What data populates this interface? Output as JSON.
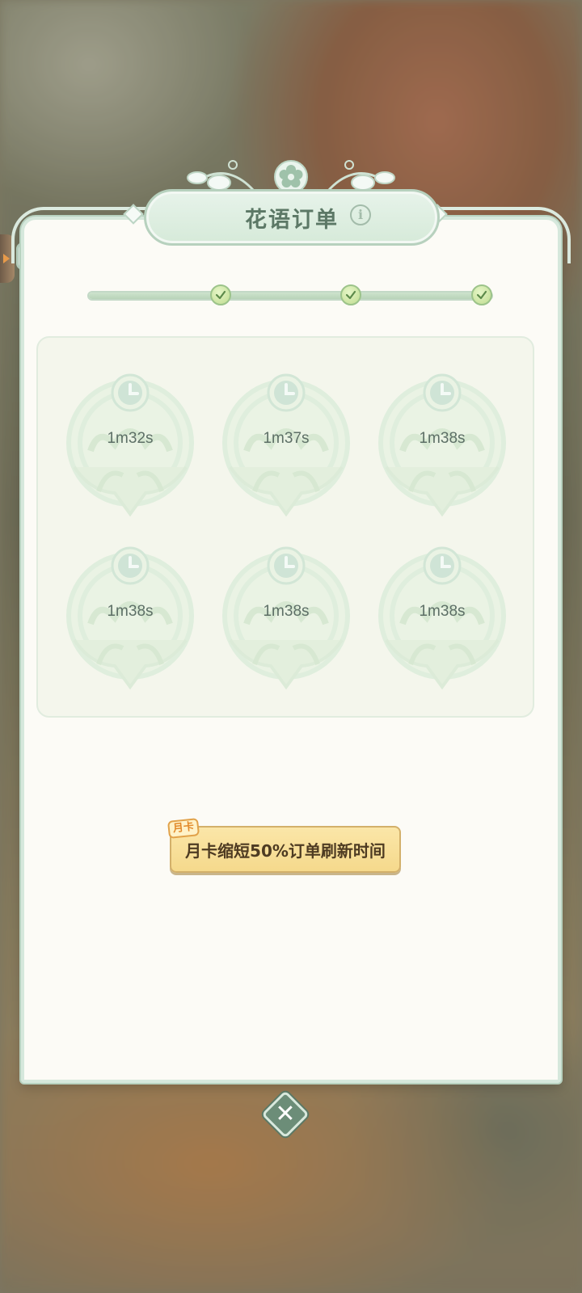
{
  "header": {
    "title": "花语订单",
    "info_icon": "info-icon"
  },
  "progress": {
    "fraction": 1.0,
    "milestones": [
      {
        "icon": "check-icon",
        "completed": true
      },
      {
        "icon": "check-icon",
        "completed": true
      },
      {
        "icon": "check-icon",
        "completed": true
      }
    ]
  },
  "orders": [
    {
      "time": "1m32s",
      "icon": "clock-icon"
    },
    {
      "time": "1m37s",
      "icon": "clock-icon"
    },
    {
      "time": "1m38s",
      "icon": "clock-icon"
    },
    {
      "time": "1m38s",
      "icon": "clock-icon"
    },
    {
      "time": "1m38s",
      "icon": "clock-icon"
    },
    {
      "time": "1m38s",
      "icon": "clock-icon"
    }
  ],
  "month_card": {
    "tag": "月卡",
    "text": "月卡缩短50%订单刷新时间"
  },
  "close": {
    "label": "✕",
    "icon": "close-icon"
  },
  "colors": {
    "panel_bg": "#fcfbf6",
    "accent_green": "#5c7866",
    "badge_gold": "#f5d98c"
  }
}
